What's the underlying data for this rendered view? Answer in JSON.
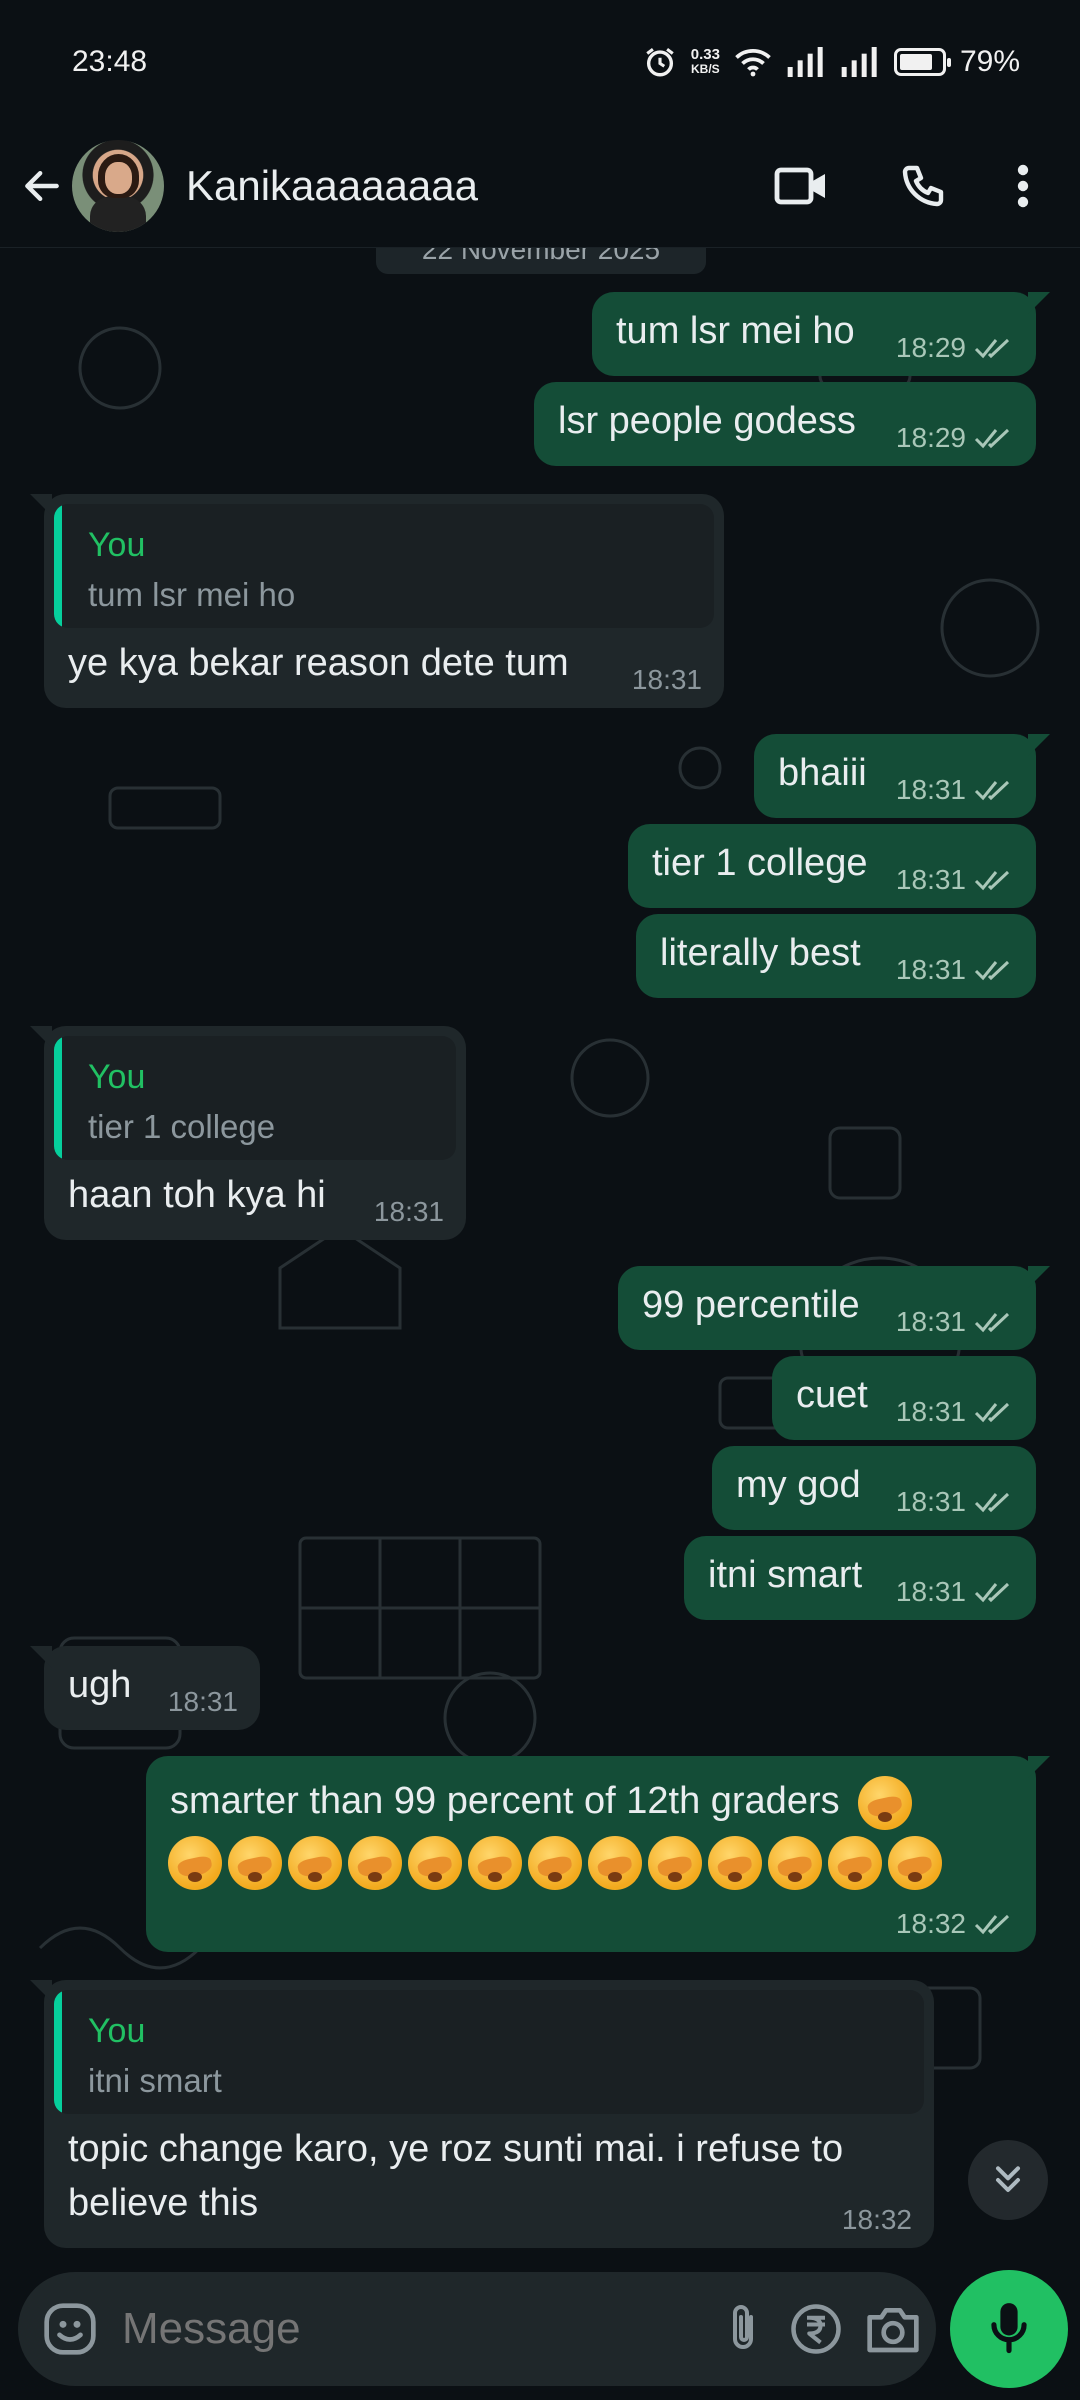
{
  "status": {
    "time": "23:48",
    "net_speed": "0.33",
    "net_unit": "KB/S",
    "battery": "79%",
    "battery_level": 0.79
  },
  "header": {
    "contact_name": "Kanikaaaaaaaa",
    "icons": [
      "back-arrow-icon",
      "video-call-icon",
      "phone-icon",
      "more-vert-icon"
    ]
  },
  "date_chip": "22 November 2025",
  "messages": [
    {
      "dir": "out",
      "text": "tum lsr mei ho",
      "time": "18:29"
    },
    {
      "dir": "out",
      "text": "lsr people godess",
      "time": "18:29"
    },
    {
      "dir": "in",
      "reply_to_author": "You",
      "reply_to_text": "tum lsr mei ho",
      "text": "ye kya bekar reason dete tum",
      "time": "18:31"
    },
    {
      "dir": "out",
      "text": "bhaiii",
      "time": "18:31"
    },
    {
      "dir": "out",
      "text": "tier 1 college",
      "time": "18:31"
    },
    {
      "dir": "out",
      "text": "literally best",
      "time": "18:31"
    },
    {
      "dir": "in",
      "reply_to_author": "You",
      "reply_to_text": "tier 1 college",
      "text": "haan toh kya hi",
      "time": "18:31"
    },
    {
      "dir": "out",
      "text": "99 percentile",
      "time": "18:31"
    },
    {
      "dir": "out",
      "text": "cuet",
      "time": "18:31"
    },
    {
      "dir": "out",
      "text": "my god",
      "time": "18:31"
    },
    {
      "dir": "out",
      "text": "itni smart",
      "time": "18:31"
    },
    {
      "dir": "in",
      "text": "ugh",
      "time": "18:31"
    },
    {
      "dir": "out",
      "text": "smarter than 99 percent of 12th graders",
      "emoji_count": 14,
      "emoji": "face-with-hand-over-mouth-emoji",
      "time": "18:32"
    },
    {
      "dir": "in",
      "reply_to_author": "You",
      "reply_to_text": "itni smart",
      "text_line1": "topic change karo, ye roz sunti mai. i refuse to",
      "text_line2": "believe this",
      "time": "18:32"
    }
  ],
  "composer": {
    "placeholder": "Message",
    "icons": [
      "emoji-icon",
      "attach-icon",
      "rupee-payment-icon",
      "camera-icon",
      "mic-icon"
    ]
  },
  "colors": {
    "background": "#0b1014",
    "outgoing": "#144d37",
    "incoming": "#1f272a",
    "accent": "#21c063"
  }
}
